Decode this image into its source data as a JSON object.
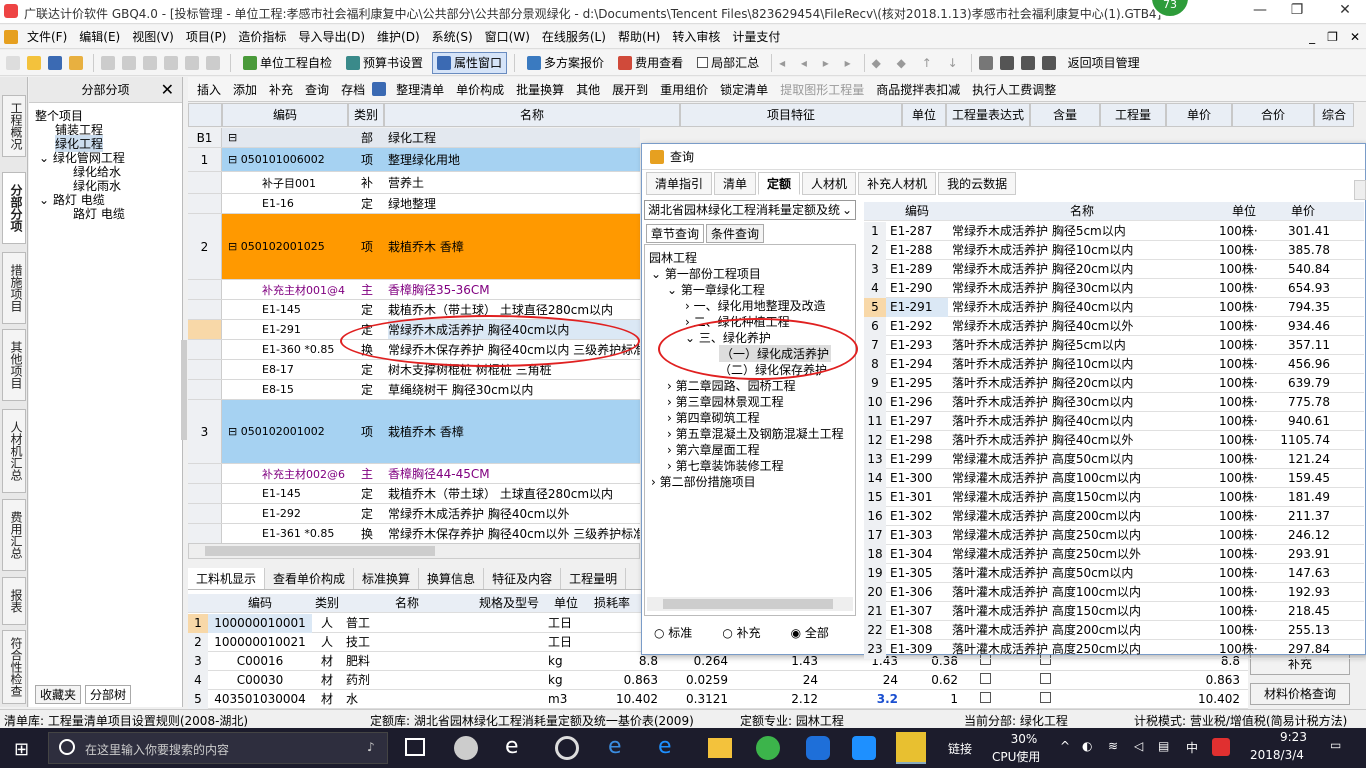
{
  "window": {
    "title": "广联达计价软件 GBQ4.0 - [投标管理 - 单位工程:孝感市社会福利康复中心\\公共部分\\公共部分景观绿化 - d:\\Documents\\Tencent Files\\823629454\\FileRecv\\(核对2018.1.13)孝感市社会福利康复中心(1).GTB4]",
    "badge": "73",
    "minimize": "—",
    "restore": "❐",
    "close": "✕"
  },
  "menu": [
    "文件(F)",
    "编辑(E)",
    "视图(V)",
    "项目(P)",
    "造价指标",
    "导入导出(D)",
    "维护(D)",
    "系统(S)",
    "窗口(W)",
    "在线服务(L)",
    "帮助(H)",
    "转入审核",
    "计量支付"
  ],
  "menu_right": [
    "_",
    "❐",
    "✕"
  ],
  "toolbar": {
    "check": "单位工程自检",
    "fee_settings": "预算书设置",
    "property_window": "属性窗口",
    "multi_scheme": "多方案报价",
    "fee_view": "费用查看",
    "local_summary": "局部汇总",
    "back": "返回项目管理"
  },
  "sidebar_tabs": [
    "工程概况",
    "分部分项",
    "措施项目",
    "其他项目",
    "人材机汇总",
    "费用汇总",
    "报表",
    "符合性检查"
  ],
  "tree": {
    "header": "分部分项",
    "close": "✕",
    "items": [
      "整个项目",
      "铺装工程",
      "绿化工程",
      "绿化管网工程",
      "绿化给水",
      "绿化雨水",
      "路灯 电缆",
      "路灯 电缆"
    ],
    "bottom_tabs": [
      "收藏夹",
      "分部树"
    ]
  },
  "grid_toolbar": [
    "插入",
    "添加",
    "补充",
    "查询",
    "存档",
    "整理清单",
    "单价构成",
    "批量换算",
    "其他",
    "展开到",
    "重用组价",
    "锁定清单",
    "提取图形工程量",
    "商品搅拌表扣减",
    "执行人工费调整"
  ],
  "grid_headers": [
    "编码",
    "类别",
    "名称",
    "项目特征",
    "单位",
    "工程量表达式",
    "含量",
    "工程量",
    "单价",
    "合价",
    "综合"
  ],
  "rows": [
    {
      "no": "B1",
      "code": "",
      "type": "部",
      "name": "绿化工程",
      "kind": "part"
    },
    {
      "no": "1",
      "code": "050101006002",
      "type": "项",
      "name": "整理绿化用地",
      "kind": "item"
    },
    {
      "no": "",
      "code": "补子目001",
      "type": "补",
      "name": "营养土",
      "kind": "sub"
    },
    {
      "no": "",
      "code": "E1-16",
      "type": "定",
      "name": "绿地整理",
      "kind": "sub"
    },
    {
      "no": "2",
      "code": "050102001025",
      "type": "项",
      "name": "栽植乔木 香樟",
      "kind": "item-orange"
    },
    {
      "no": "",
      "code": "补充主材001@4",
      "type": "主",
      "name": "香樟胸径35-36CM",
      "kind": "main"
    },
    {
      "no": "",
      "code": "E1-145",
      "type": "定",
      "name": "栽植乔木（带土球） 土球直径280cm以内",
      "kind": "sub"
    },
    {
      "no": "",
      "code": "E1-291",
      "type": "定",
      "name": "常绿乔木成活养护 胸径40cm以内",
      "kind": "sub-sel"
    },
    {
      "no": "",
      "code": "E1-360 *0.85",
      "type": "换",
      "name": "常绿乔木保存养护 胸径40cm以内 三级养护标准",
      "kind": "sub"
    },
    {
      "no": "",
      "code": "E8-17",
      "type": "定",
      "name": "树木支撑树棍桩 树棍桩 三角桩",
      "kind": "sub"
    },
    {
      "no": "",
      "code": "E8-15",
      "type": "定",
      "name": "草绳绕树干 胸径30cm以内",
      "kind": "sub"
    },
    {
      "no": "3",
      "code": "050102001002",
      "type": "项",
      "name": "栽植乔木 香樟",
      "kind": "item"
    },
    {
      "no": "",
      "code": "补充主材002@6",
      "type": "主",
      "name": "香樟胸径44-45CM",
      "kind": "main"
    },
    {
      "no": "",
      "code": "E1-145",
      "type": "定",
      "name": "栽植乔木（带土球） 土球直径280cm以内",
      "kind": "sub"
    },
    {
      "no": "",
      "code": "E1-292",
      "type": "定",
      "name": "常绿乔木成活养护 胸径40cm以外",
      "kind": "sub"
    },
    {
      "no": "",
      "code": "E1-361 *0.85",
      "type": "换",
      "name": "常绿乔木保存养护 胸径40cm以外 三级养护标准",
      "kind": "sub"
    }
  ],
  "bottom": {
    "tabs": [
      "工料机显示",
      "查看单价构成",
      "标准换算",
      "换算信息",
      "特征及内容",
      "工程量明"
    ],
    "headers": [
      "编码",
      "类别",
      "名称",
      "规格及型号",
      "单位",
      "损耗率"
    ],
    "rows": [
      {
        "no": "1",
        "code": "100000010001",
        "type": "人",
        "name": "普工",
        "unit": "工日",
        "v": [
          "",
          "",
          "",
          "",
          "",
          ""
        ]
      },
      {
        "no": "2",
        "code": "100000010021",
        "type": "人",
        "name": "技工",
        "unit": "工日",
        "v": [
          "",
          "",
          "",
          "",
          "",
          ""
        ]
      },
      {
        "no": "3",
        "code": "C00016",
        "type": "材",
        "name": "肥料",
        "unit": "kg",
        "v": [
          "8.8",
          "0.264",
          "1.43",
          "1.43",
          "0.38",
          "8.8"
        ]
      },
      {
        "no": "4",
        "code": "C00030",
        "type": "材",
        "name": "药剂",
        "unit": "kg",
        "v": [
          "0.863",
          "0.0259",
          "24",
          "24",
          "0.62",
          "0.863"
        ]
      },
      {
        "no": "5",
        "code": "403501030004",
        "type": "材",
        "name": "水",
        "unit": "m3",
        "v": [
          "10.402",
          "0.3121",
          "2.12",
          "3.2",
          "1",
          "10.402"
        ]
      }
    ],
    "buttons": [
      "补充",
      "材料价格查询"
    ]
  },
  "dialog": {
    "title": "查询",
    "tabs": [
      "清单指引",
      "清单",
      "定额",
      "人材机",
      "补充人材机",
      "我的云数据"
    ],
    "library": "湖北省园林绿化工程消耗量定额及统",
    "subtabs": [
      "章节查询",
      "条件查询"
    ],
    "tree": [
      "园林工程",
      "第一部份工程项目",
      "第一章绿化工程",
      "一、绿化用地整理及改造",
      "二、绿化种植工程",
      "三、绿化养护",
      "（一）绿化成活养护",
      "（二）绿化保存养护",
      "第二章园路、园桥工程",
      "第三章园林景观工程",
      "第四章砌筑工程",
      "第五章混凝土及钢筋混凝土工程",
      "第六章屋面工程",
      "第七章装饰装修工程",
      "第二部份措施项目"
    ],
    "radios": [
      "标准",
      "补充",
      "全部"
    ],
    "headers": [
      "编码",
      "名称",
      "单位",
      "单价"
    ],
    "rows": [
      [
        "E1-287",
        "常绿乔木成活养护 胸径5cm以内",
        "100株·",
        "301.41"
      ],
      [
        "E1-288",
        "常绿乔木成活养护 胸径10cm以内",
        "100株·",
        "385.78"
      ],
      [
        "E1-289",
        "常绿乔木成活养护 胸径20cm以内",
        "100株·",
        "540.84"
      ],
      [
        "E1-290",
        "常绿乔木成活养护 胸径30cm以内",
        "100株·",
        "654.93"
      ],
      [
        "E1-291",
        "常绿乔木成活养护 胸径40cm以内",
        "100株·",
        "794.35"
      ],
      [
        "E1-292",
        "常绿乔木成活养护 胸径40cm以外",
        "100株·",
        "934.46"
      ],
      [
        "E1-293",
        "落叶乔木成活养护 胸径5cm以内",
        "100株·",
        "357.11"
      ],
      [
        "E1-294",
        "落叶乔木成活养护 胸径10cm以内",
        "100株·",
        "456.96"
      ],
      [
        "E1-295",
        "落叶乔木成活养护 胸径20cm以内",
        "100株·",
        "639.79"
      ],
      [
        "E1-296",
        "落叶乔木成活养护 胸径30cm以内",
        "100株·",
        "775.78"
      ],
      [
        "E1-297",
        "落叶乔木成活养护 胸径40cm以内",
        "100株·",
        "940.61"
      ],
      [
        "E1-298",
        "落叶乔木成活养护 胸径40cm以外",
        "100株·",
        "1105.74"
      ],
      [
        "E1-299",
        "常绿灌木成活养护 高度50cm以内",
        "100株·",
        "121.24"
      ],
      [
        "E1-300",
        "常绿灌木成活养护 高度100cm以内",
        "100株·",
        "159.45"
      ],
      [
        "E1-301",
        "常绿灌木成活养护 高度150cm以内",
        "100株·",
        "181.49"
      ],
      [
        "E1-302",
        "常绿灌木成活养护 高度200cm以内",
        "100株·",
        "211.37"
      ],
      [
        "E1-303",
        "常绿灌木成活养护 高度250cm以内",
        "100株·",
        "246.12"
      ],
      [
        "E1-304",
        "常绿灌木成活养护 高度250cm以外",
        "100株·",
        "293.91"
      ],
      [
        "E1-305",
        "落叶灌木成活养护 高度50cm以内",
        "100株·",
        "147.63"
      ],
      [
        "E1-306",
        "落叶灌木成活养护 高度100cm以内",
        "100株·",
        "192.93"
      ],
      [
        "E1-307",
        "落叶灌木成活养护 高度150cm以内",
        "100株·",
        "218.45"
      ],
      [
        "E1-308",
        "落叶灌木成活养护 高度200cm以内",
        "100株·",
        "255.13"
      ],
      [
        "E1-309",
        "落叶灌木成活养护 高度250cm以内",
        "100株·",
        "297.84"
      ]
    ]
  },
  "status": {
    "list": "清单库: 工程量清单项目设置规则(2008-湖北)",
    "quota": "定额库: 湖北省园林绿化工程消耗量定额及统一基价表(2009)",
    "major": "定额专业: 园林工程",
    "current": "当前分部: 绿化工程",
    "tax": "计税模式: 营业税/增值税(简易计税方法)"
  },
  "taskbar": {
    "search": "在这里输入你要搜索的内容",
    "link": "链接",
    "cpu": "30%",
    "cpu_label": "CPU使用",
    "ime": "中",
    "time": "9:23",
    "date": "2018/3/4"
  },
  "colors": {
    "orange": "#ff9900",
    "blue_row": "#a6d2f2",
    "purple": "#800080",
    "title_blue": "#1a5aa0"
  }
}
